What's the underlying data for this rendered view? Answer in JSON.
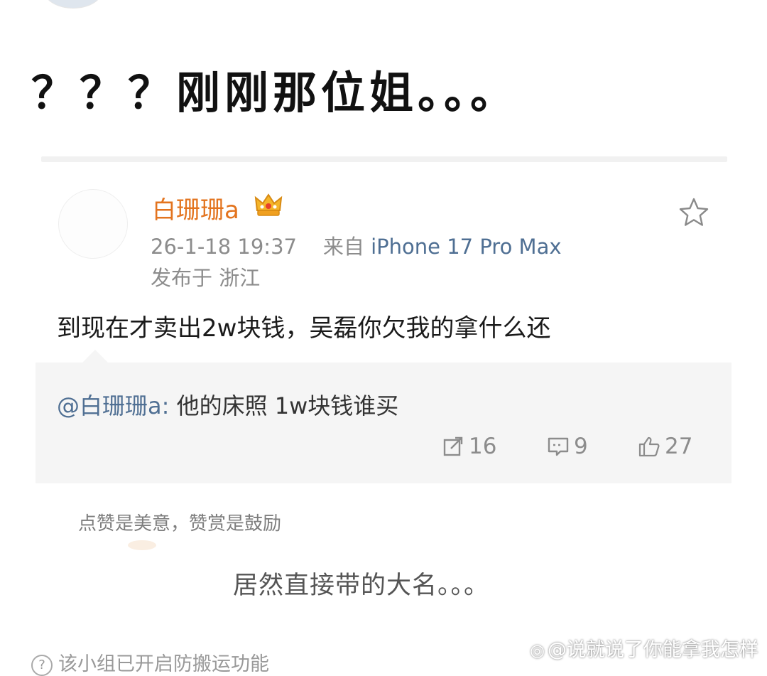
{
  "headline": "？？？刚刚那位姐。。。",
  "post": {
    "username": "白珊珊a",
    "date": "26-1-18 19:37",
    "from_label": "来自",
    "device": "iPhone 17 Pro Max",
    "location": "发布于 浙江",
    "text": "到现在才卖出2w块钱，吴磊你欠我的拿什么还",
    "quote": {
      "mention": "@白珊珊a:",
      "text": " 他的床照 1w块钱谁买"
    },
    "actions": {
      "repost_count": "16",
      "comment_count": "9",
      "like_count": "27"
    }
  },
  "reward_hint": "点赞是美意，赞赏是鼓励",
  "caption": "居然直接带的大名。。。",
  "bottom_notice": "该小组已开启防搬运功能",
  "watermark": "@说就说了你能拿我怎样",
  "colors": {
    "username": "#e3741f",
    "link": "#4f6f93",
    "meta": "#8c8c8c",
    "quote_bg": "#f5f5f5"
  }
}
